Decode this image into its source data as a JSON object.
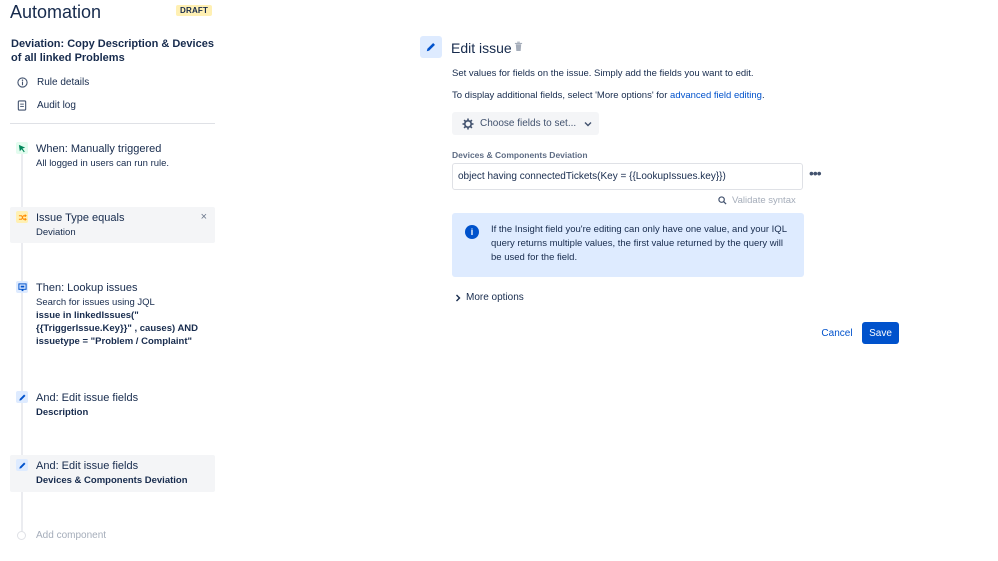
{
  "app": {
    "title": "Automation",
    "badge": "DRAFT",
    "rule_name": "Deviation: Copy Description & Devices of all linked Problems"
  },
  "nav": [
    {
      "label": "Rule details",
      "icon": "info-icon"
    },
    {
      "label": "Audit log",
      "icon": "document-icon"
    }
  ],
  "components": [
    {
      "title": "When: Manually triggered",
      "subtitle": "All logged in users can run rule.",
      "icon": "trigger-cursor-icon",
      "color": "#36b37e"
    },
    {
      "title": "Issue Type equals",
      "subtitle": "Deviation",
      "icon": "shuffle-icon",
      "color": "#ffab00",
      "close": "×"
    },
    {
      "title": "Then: Lookup issues",
      "subtitle": "Search for issues using JQL",
      "jql_line1": "issue in linkedIssues(\"",
      "jql_line2": "{{TriggerIssue.Key}}\" , causes) AND",
      "jql_line3": "issuetype = \"Problem / Complaint\"",
      "icon": "lookup-icon",
      "color": "#0052cc"
    },
    {
      "title": "And: Edit issue fields",
      "subtitle": "Description",
      "icon": "pencil-icon",
      "color": "#0052cc"
    },
    {
      "title": "And: Edit issue fields",
      "subtitle": "Devices & Components Deviation",
      "icon": "pencil-icon",
      "color": "#0052cc"
    }
  ],
  "add_component": "Add component",
  "main": {
    "title": "Edit issue",
    "desc1": "Set values for fields on the issue. Simply add the fields you want to edit.",
    "desc2_prefix": "To display additional fields, select 'More options' for ",
    "desc2_link": "advanced field editing",
    "desc2_suffix": ".",
    "choose_fields": "Choose fields to set...",
    "field_label": "Devices & Components Deviation",
    "field_value": "object having connectedTickets(Key = {{LookupIssues.key}})",
    "more_dots": "•••",
    "validate": "Validate syntax",
    "info_text": "If the Insight field you're editing can only have one value, and your IQL query returns multiple values, the first value returned by the query will be used for the field.",
    "info_glyph": "i",
    "more_options": "More options",
    "cancel": "Cancel",
    "save": "Save"
  },
  "colors": {
    "accent": "#0052cc",
    "info_bg": "#deebff",
    "draft_bg": "#fff0b3",
    "selected_bg": "#f4f5f7"
  }
}
